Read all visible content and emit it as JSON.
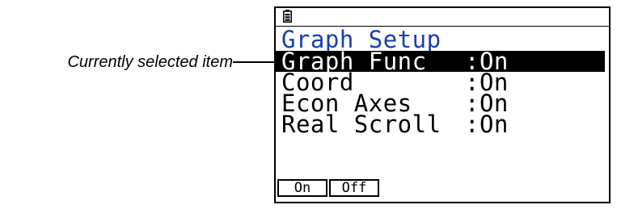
{
  "callout": {
    "label": "Currently selected item"
  },
  "screen": {
    "status_icon": "battery-icon",
    "title": "Graph Setup",
    "title_color": "#1a3fa8",
    "items": [
      {
        "name": "Graph Func",
        "value": ":On",
        "selected": true
      },
      {
        "name": "Coord",
        "value": ":On",
        "selected": false
      },
      {
        "name": "Econ Axes",
        "value": ":On",
        "selected": false
      },
      {
        "name": "Real Scroll",
        "value": ":On",
        "selected": false
      }
    ],
    "function_keys": [
      {
        "label": "On"
      },
      {
        "label": "Off"
      }
    ]
  }
}
